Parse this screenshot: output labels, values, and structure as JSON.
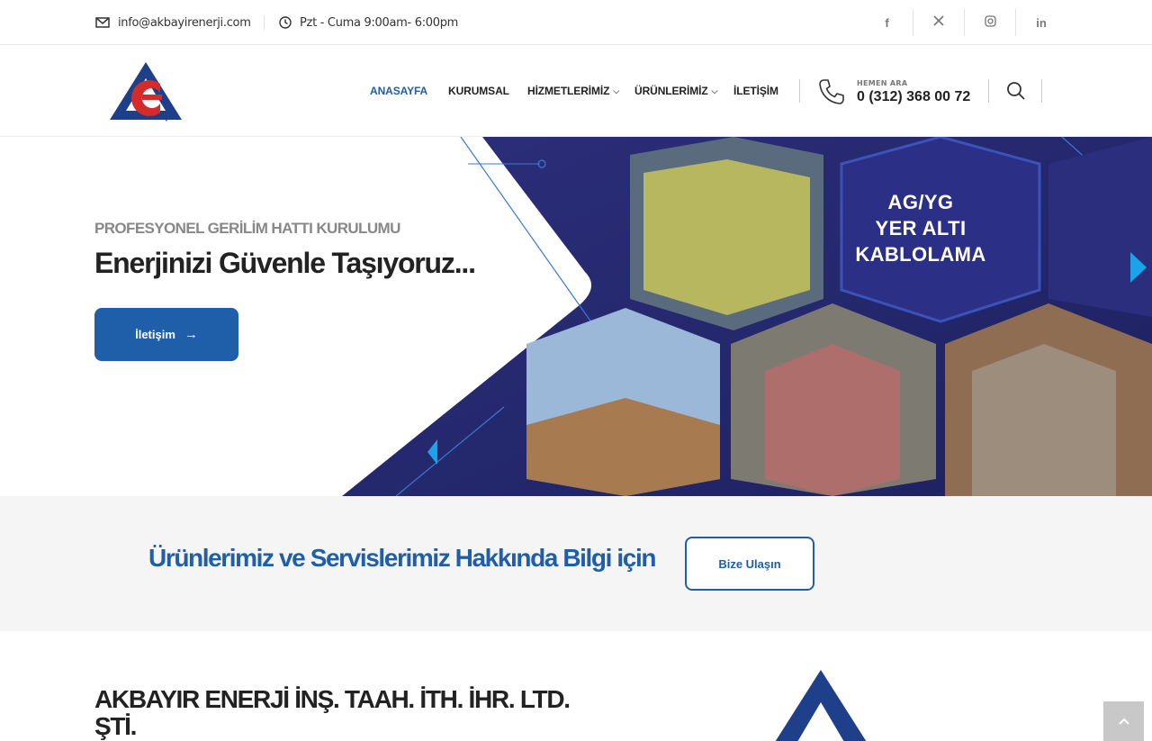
{
  "topbar": {
    "email": "info@akbayirenerji.com",
    "hours": "Pzt - Cuma 9:00am- 6:00pm",
    "social": [
      {
        "icon": "facebook-icon",
        "glyph": "f"
      },
      {
        "icon": "x-twitter-icon",
        "glyph": "𝕏"
      },
      {
        "icon": "instagram-icon",
        "glyph": "◎"
      },
      {
        "icon": "linkedin-icon",
        "glyph": "in"
      }
    ]
  },
  "header": {
    "logo_text": "AKBAYIR ENERJİ",
    "nav": [
      {
        "label": "ANASAYFA",
        "active": true,
        "dropdown": false
      },
      {
        "label": "KURUMSAL",
        "active": false,
        "dropdown": false
      },
      {
        "label": "HİZMETLERİMİZ",
        "active": false,
        "dropdown": true
      },
      {
        "label": "ÜRÜNLERİMİZ",
        "active": false,
        "dropdown": true
      },
      {
        "label": "İLETİŞİM",
        "active": false,
        "dropdown": false
      }
    ],
    "phone_label": "HEMEN ARA",
    "phone_number": "0 (312) 368 00 72"
  },
  "hero": {
    "subtitle": "PROFESYONEL GERİLİM HATTI KURULUMU",
    "title": "Enerjinizi Güvenle Taşıyoruz...",
    "button_label": "İletişim",
    "badge_lines": [
      "AG/YG",
      "YER ALTI",
      "KABLOLAMA"
    ]
  },
  "cta": {
    "text": "Ürünlerimiz ve Servislerimiz Hakkında Bilgi için",
    "button_label": "Bize Ulaşın"
  },
  "about": {
    "title": "AKBAYIR ENERJİ İNŞ. TAAH. İTH. İHR. LTD. ŞTİ."
  },
  "colors": {
    "brand_blue": "#1f5ea8",
    "navy": "#262a6b",
    "logo_red": "#d62b2b",
    "cta_bg": "#f5f5f5"
  }
}
